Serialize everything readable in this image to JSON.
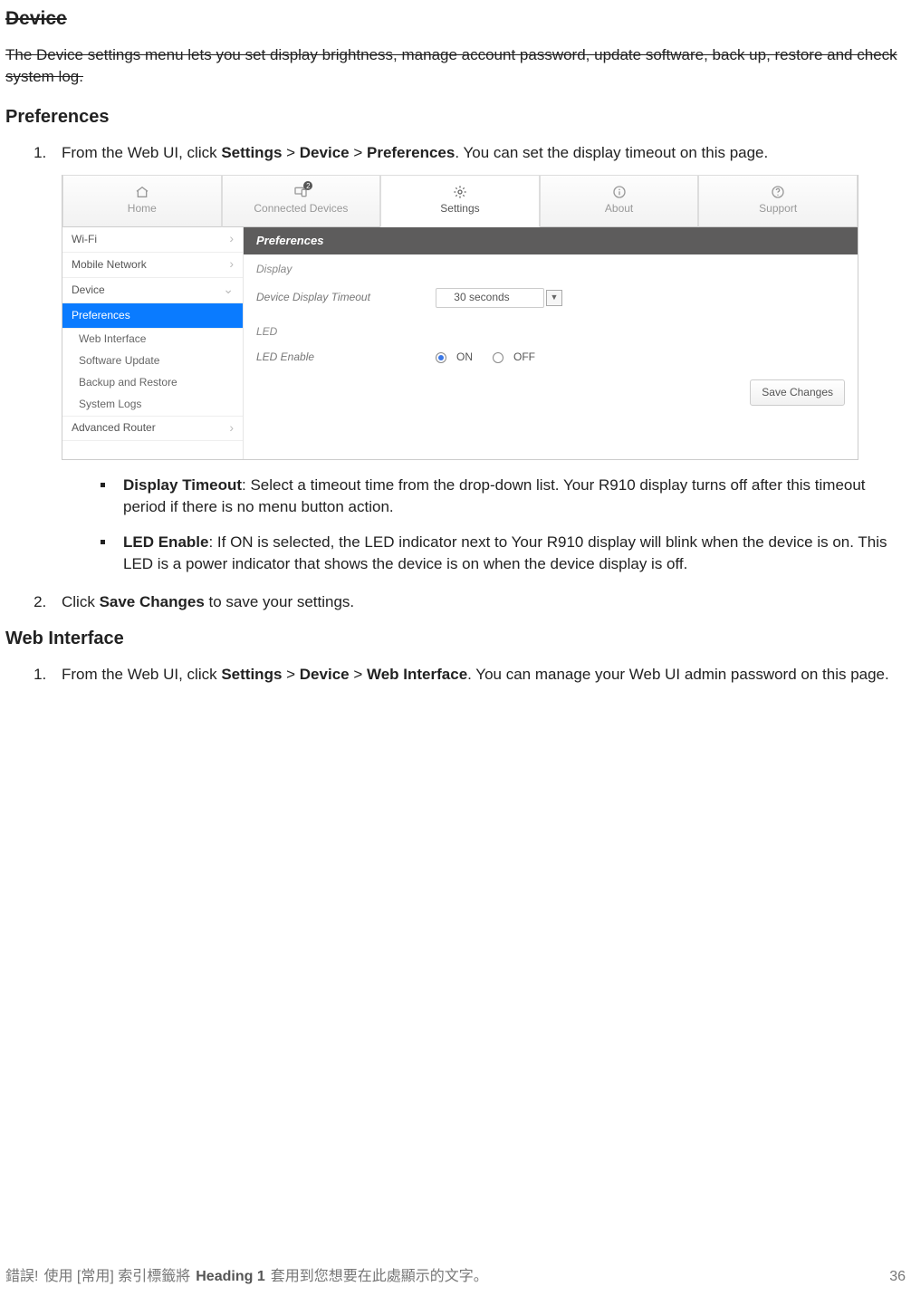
{
  "doc": {
    "h1": "Device",
    "intro": "The Device settings menu lets you set display brightness, manage account password, update software, back up, restore and check system log.",
    "h2_preferences": "Preferences",
    "step1_a": "From the Web UI, click ",
    "step1_b": "Settings",
    "step1_c": " > ",
    "step1_d": "Device",
    "step1_e": " > ",
    "step1_f": "Preferences",
    "step1_g": ". You can set the display timeout on this page.",
    "bullet1_head": "Display Timeout",
    "bullet1_body": ": Select a timeout time from the drop-down list. Your R910 display turns off after this timeout period if there is no menu button action.",
    "bullet2_head": "LED Enable",
    "bullet2_body": ": If ON is selected, the LED indicator next to Your R910 display will blink when the device is on. This LED is a power indicator that shows the device is on when the device display is off.",
    "step2_a": "Click ",
    "step2_b": "Save Changes",
    "step2_c": " to save your settings.",
    "h2_web": "Web Interface",
    "web_step1_a": "From the Web UI, click ",
    "web_step1_b": "Settings",
    "web_step1_c": " > ",
    "web_step1_d": "Device",
    "web_step1_e": " > ",
    "web_step1_f": "Web Interface",
    "web_step1_g": ". You can manage your Web UI admin password on this page."
  },
  "shot": {
    "tabs": {
      "home": "Home",
      "devices": "Connected Devices",
      "settings": "Settings",
      "about": "About",
      "support": "Support",
      "devices_badge": "2"
    },
    "sidebar": {
      "wifi": "Wi-Fi",
      "mobile": "Mobile Network",
      "device": "Device",
      "preferences": "Preferences",
      "web": "Web Interface",
      "swupdate": "Software Update",
      "backup": "Backup and Restore",
      "syslogs": "System Logs",
      "advrouter": "Advanced Router"
    },
    "content": {
      "header": "Preferences",
      "section_display": "Display",
      "row_timeout_label": "Device Display Timeout",
      "row_timeout_value": "30 seconds",
      "section_led": "LED",
      "row_led_label": "LED Enable",
      "on": "ON",
      "off": "OFF",
      "save": "Save Changes"
    }
  },
  "footer": {
    "err": "錯誤!",
    "text_a": " 使用 [常用] 索引標籤將 ",
    "heading": "Heading 1",
    "text_b": " 套用到您想要在此處顯示的文字。",
    "page": "36"
  }
}
